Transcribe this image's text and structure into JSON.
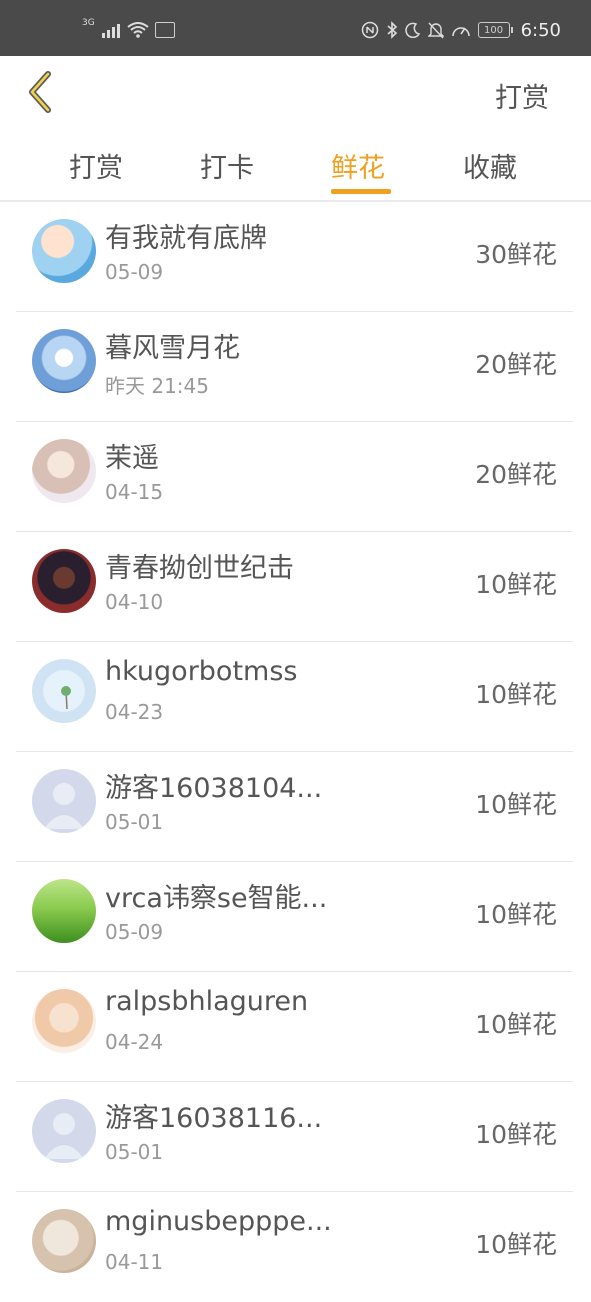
{
  "status_bar": {
    "network": "3G",
    "icons": [
      "signal-icon",
      "wifi-icon",
      "hms-icon",
      "nfc-icon",
      "bluetooth-icon",
      "moon-icon",
      "bell-off-icon",
      "speed-icon",
      "battery-icon"
    ],
    "battery": "100",
    "time": "6:50"
  },
  "header": {
    "back_icon": "chevron-left-icon",
    "action_label": "打赏"
  },
  "tabs": [
    {
      "label": "打赏",
      "active": false
    },
    {
      "label": "打卡",
      "active": false
    },
    {
      "label": "鲜花",
      "active": true
    },
    {
      "label": "收藏",
      "active": false
    }
  ],
  "colors": {
    "accent": "#f0a020",
    "status_bar_bg": "#4a4a4a"
  },
  "list": [
    {
      "name": "有我就有底牌",
      "date": "05-09",
      "amount": "30鲜花"
    },
    {
      "name": "暮风雪月花",
      "date": "昨天 21:45",
      "amount": "20鲜花"
    },
    {
      "name": "茉遥",
      "date": "04-15",
      "amount": "20鲜花"
    },
    {
      "name": "青春拗创世纪击",
      "date": "04-10",
      "amount": "10鲜花"
    },
    {
      "name": "hkugorbotmss",
      "date": "04-23",
      "amount": "10鲜花"
    },
    {
      "name": "游客16038104...",
      "date": "05-01",
      "amount": "10鲜花"
    },
    {
      "name": "vrca讳察se智能...",
      "date": "05-09",
      "amount": "10鲜花"
    },
    {
      "name": "ralpsbhlaguren",
      "date": "04-24",
      "amount": "10鲜花"
    },
    {
      "name": "游客16038116...",
      "date": "05-01",
      "amount": "10鲜花"
    },
    {
      "name": "mginusbepppe...",
      "date": "04-11",
      "amount": "10鲜花"
    }
  ]
}
